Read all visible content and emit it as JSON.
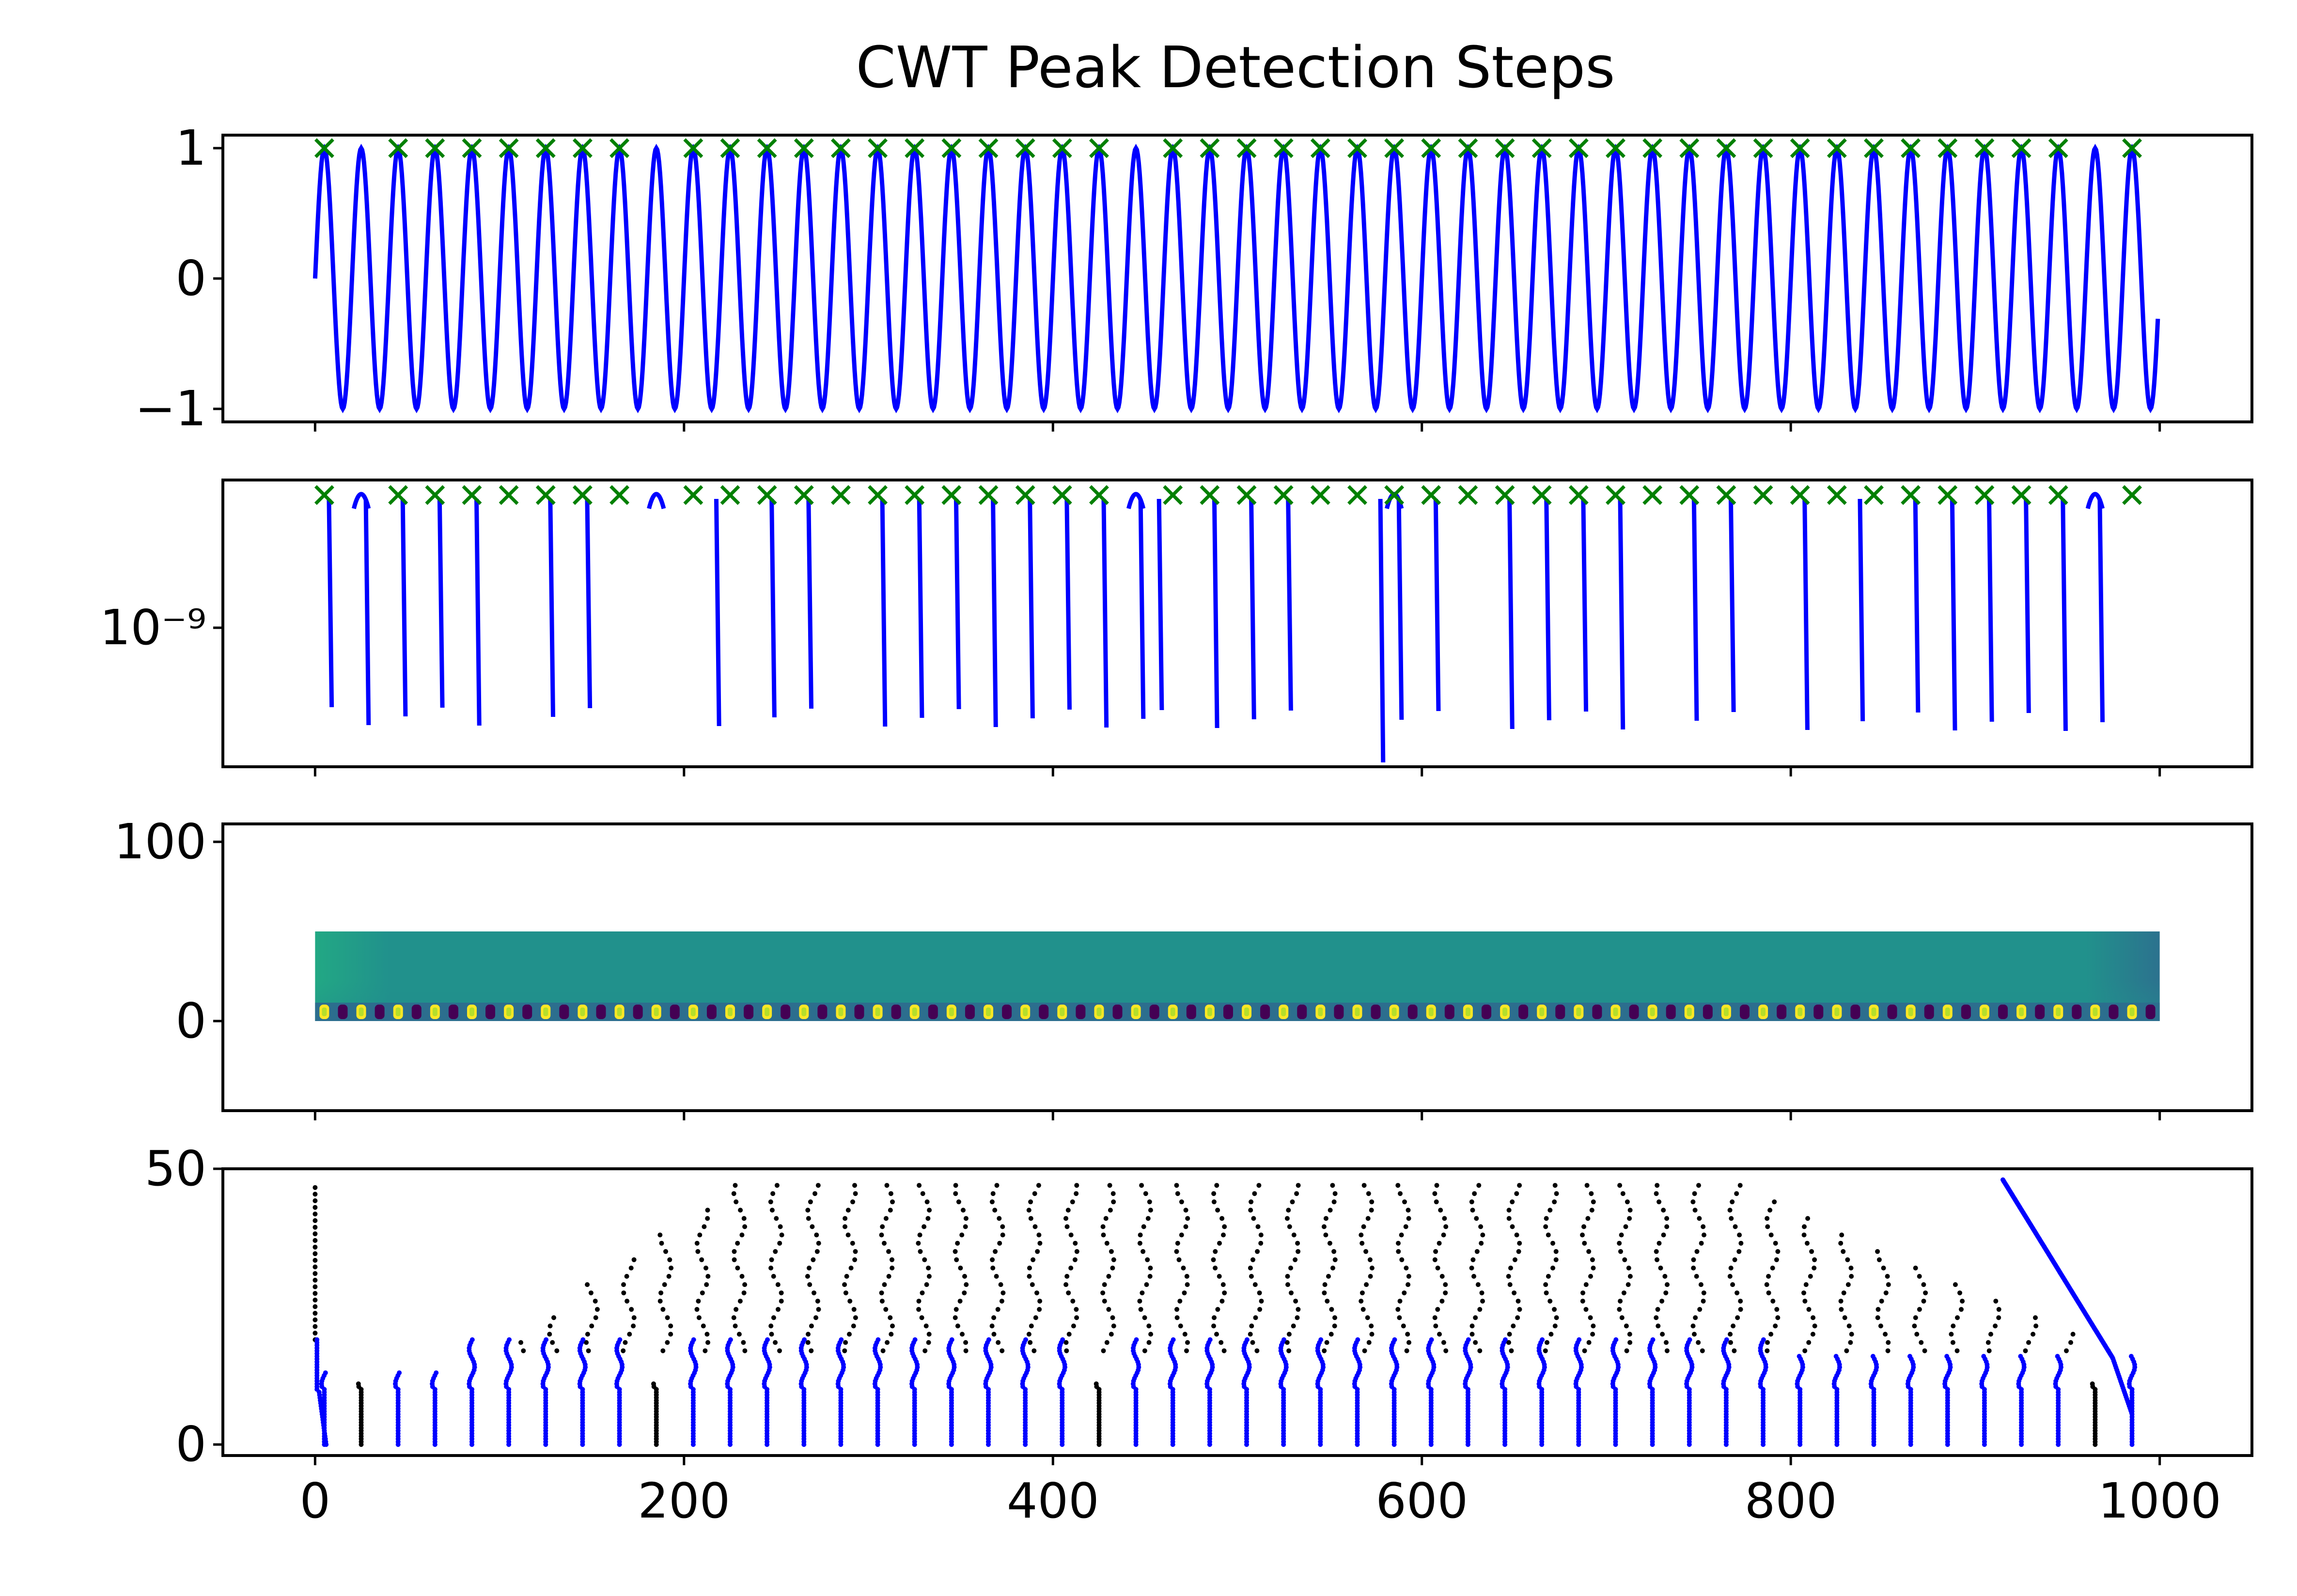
{
  "figure": {
    "title": "CWT Peak Detection Steps"
  },
  "chart_data": [
    {
      "type": "line",
      "panel": "signal",
      "title": "CWT Peak Detection Steps",
      "series": [
        {
          "values_description": "sin(2*pi*x/20), x = 0..999",
          "color": "#0000ff",
          "values": "sin"
        }
      ],
      "x_range": [
        0,
        999
      ],
      "period": 20,
      "xlim": [
        -50,
        1050
      ],
      "ylim": [
        -1.1,
        1.1
      ],
      "yticks": [
        1,
        0,
        -1
      ],
      "ytick_labels": [
        "1",
        "0",
        "−1"
      ],
      "markers": {
        "symbol": "x",
        "color": "#008000",
        "y": 1.0
      },
      "marker_x": [
        5,
        45,
        65,
        85,
        105,
        125,
        145,
        165,
        205,
        225,
        245,
        265,
        285,
        305,
        325,
        345,
        365,
        385,
        405,
        425,
        465,
        485,
        505,
        525,
        545,
        565,
        585,
        605,
        625,
        645,
        665,
        685,
        705,
        725,
        745,
        765,
        785,
        805,
        825,
        845,
        865,
        885,
        905,
        925,
        945,
        985
      ]
    },
    {
      "type": "line",
      "panel": "log-signal",
      "scale": "log",
      "ytick_labels": [
        "10⁻⁹"
      ],
      "series": [
        {
          "color": "#0000ff"
        }
      ],
      "markers": {
        "symbol": "x",
        "color": "#008000"
      },
      "marker_x": [
        5,
        45,
        65,
        85,
        105,
        125,
        145,
        165,
        205,
        225,
        245,
        265,
        285,
        305,
        325,
        345,
        365,
        385,
        405,
        425,
        465,
        485,
        505,
        525,
        545,
        565,
        585,
        605,
        625,
        645,
        665,
        685,
        705,
        725,
        745,
        765,
        785,
        805,
        825,
        845,
        865,
        885,
        905,
        925,
        945,
        985
      ],
      "dip_x": [
        10,
        30,
        50,
        70,
        90,
        130,
        150,
        220,
        250,
        270,
        310,
        330,
        350,
        370,
        390,
        410,
        430,
        450,
        460,
        490,
        510,
        530,
        580,
        590,
        610,
        650,
        670,
        690,
        710,
        750,
        770,
        810,
        840,
        870,
        890,
        910,
        930,
        950,
        970
      ],
      "bump_x": [
        25,
        185,
        445,
        585,
        965
      ]
    },
    {
      "type": "heatmap",
      "panel": "cwt-matrix",
      "xlim": [
        -50,
        1050
      ],
      "ylim": [
        -50,
        110
      ],
      "yticks": [
        100,
        0
      ],
      "ytick_labels": [
        "100",
        "0"
      ],
      "extent": {
        "x": [
          0,
          1000
        ],
        "y": [
          0,
          50
        ]
      },
      "colormap": "viridis"
    },
    {
      "type": "scatter",
      "panel": "ridge-lines",
      "xlim": [
        -50,
        1050
      ],
      "ylim": [
        -2,
        50
      ],
      "yticks": [
        50,
        0
      ],
      "ytick_labels": [
        "50",
        "0"
      ],
      "xticks": [
        0,
        200,
        400,
        600,
        800,
        1000
      ],
      "xtick_labels": [
        "0",
        "200",
        "400",
        "600",
        "800",
        "1000"
      ],
      "colors": {
        "ridge": "#0000ff",
        "other": "#000000"
      }
    }
  ]
}
